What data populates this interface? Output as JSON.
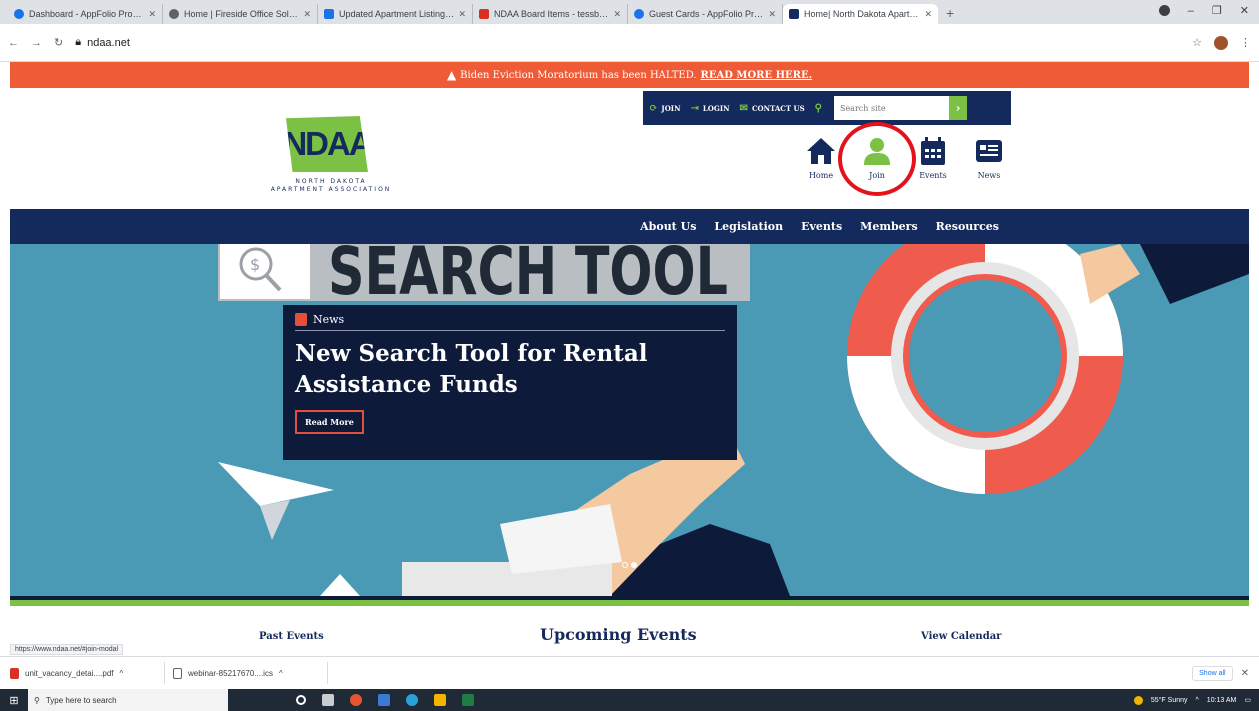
{
  "browser": {
    "tabs": [
      {
        "title": "Dashboard - AppFolio Property",
        "color": "#1a73e8"
      },
      {
        "title": "Home | Fireside Office Solutions",
        "color": "#5f6368"
      },
      {
        "title": "Updated Apartment Listing - Go",
        "color": "#1a73e8"
      },
      {
        "title": "NDAA Board Items - tessbetaoc",
        "color": "#d93025"
      },
      {
        "title": "Guest Cards - AppFolio Property",
        "color": "#1a73e8"
      },
      {
        "title": "Home| North Dakota Apartment",
        "color": "#152a5c"
      }
    ],
    "url": "ndaa.net"
  },
  "site": {
    "alert": {
      "text": "Biden Eviction Moratorium has been HALTED.",
      "link": "READ MORE HERE."
    },
    "utility": {
      "join": "JOIN",
      "login": "LOGIN",
      "contact": "CONTACT US",
      "search_placeholder": "Search site"
    },
    "logo": {
      "mark": "NDAA",
      "line1": "NORTH DAKOTA",
      "line2": "APARTMENT ASSOCIATION"
    },
    "quick_nav": [
      {
        "label": "Home",
        "icon": "home-icon"
      },
      {
        "label": "Join",
        "icon": "person-icon"
      },
      {
        "label": "Events",
        "icon": "calendar-icon"
      },
      {
        "label": "News",
        "icon": "news-icon"
      }
    ],
    "main_nav": [
      "About Us",
      "Legislation",
      "Events",
      "Members",
      "Resources"
    ],
    "hero": {
      "bg_word": "SEARCH TOOL",
      "category": "News",
      "headline": "New Search Tool for Rental Assistance Funds",
      "button": "Read More"
    },
    "events": {
      "past": "Past Events",
      "upcoming": "Upcoming Events",
      "calendar": "View Calendar"
    },
    "status_url": "https://www.ndaa.net/#join-modal"
  },
  "downloads": {
    "items": [
      {
        "name": "unit_vacancy_detai....pdf",
        "color": "#d93025"
      },
      {
        "name": "webinar-85217670....ics",
        "color": "#5f6368"
      }
    ],
    "show_all": "Show all"
  },
  "taskbar": {
    "search_placeholder": "Type here to search",
    "weather": "55°F Sunny",
    "time": "10:13 AM"
  },
  "colors": {
    "navy": "#152a5c",
    "green": "#7bc143",
    "alert": "#ef5b36",
    "highlight": "#e3121b"
  }
}
